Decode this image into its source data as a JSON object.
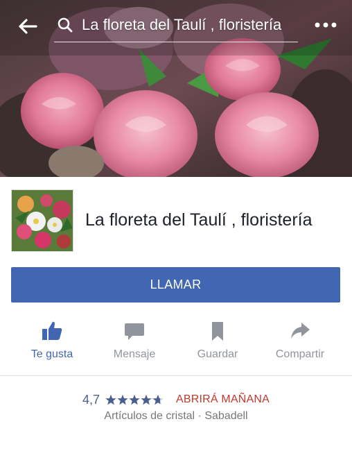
{
  "header": {
    "search_text": "La floreta del Taulí , floristería"
  },
  "page": {
    "name": "La floreta del Taulí , floristería"
  },
  "call_button": {
    "label": "LLAMAR",
    "color": "#4267b2"
  },
  "actions": [
    {
      "label": "Te gusta",
      "icon": "thumbs-up-icon",
      "active": true
    },
    {
      "label": "Mensaje",
      "icon": "message-icon",
      "active": false
    },
    {
      "label": "Guardar",
      "icon": "bookmark-icon",
      "active": false
    },
    {
      "label": "Compartir",
      "icon": "share-icon",
      "active": false
    }
  ],
  "rating": {
    "value": "4,7",
    "stars": 4.7,
    "status": "ABRIRÁ MAÑANA"
  },
  "meta": "Artículos de cristal · Sabadell",
  "colors": {
    "accent": "#4267b2",
    "status": "#c0392b",
    "muted": "#90949c"
  }
}
